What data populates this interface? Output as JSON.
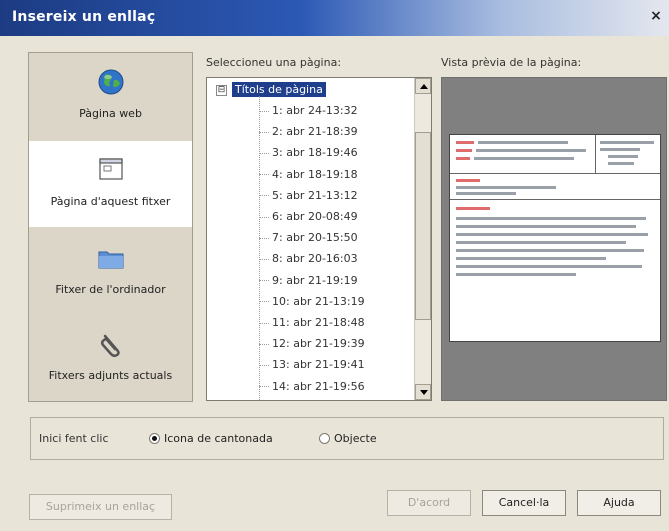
{
  "window": {
    "title": "Insereix un enllaç",
    "close_glyph": "×"
  },
  "nav": {
    "items": [
      {
        "label": "Pàgina web",
        "icon": "globe-icon",
        "selected": false
      },
      {
        "label": "Pàgina d'aquest fitxer",
        "icon": "page-icon",
        "selected": true
      },
      {
        "label": "Fitxer de l'ordinador",
        "icon": "folder-icon",
        "selected": false
      },
      {
        "label": "Fitxers adjunts actuals",
        "icon": "paperclip-icon",
        "selected": false
      }
    ]
  },
  "select_page": {
    "label": "Seleccioneu una pàgina:",
    "root": {
      "label": "Títols de pàgina",
      "expander": "⊟"
    },
    "items": [
      "1: abr 24-13:32",
      "2: abr 21-18:39",
      "3: abr 18-19:46",
      "4: abr 18-19:18",
      "5: abr 21-13:12",
      "6: abr 20-08:49",
      "7: abr 20-15:50",
      "8: abr 20-16:03",
      "9: abr 21-19:19",
      "10: abr 21-13:19",
      "11: abr 21-18:48",
      "12: abr 21-19:39",
      "13: abr 21-19:41",
      "14: abr 21-19:56"
    ]
  },
  "preview": {
    "label": "Vista prèvia de la pàgina:"
  },
  "start_click": {
    "caption": "Inici fent clic",
    "options": [
      {
        "label": "Icona de cantonada",
        "checked": true
      },
      {
        "label": "Objecte",
        "checked": false
      }
    ]
  },
  "buttons": {
    "remove_link": "Suprimeix un enllaç",
    "ok": "D'acord",
    "cancel": "Cancel·la",
    "help": "Ajuda"
  }
}
